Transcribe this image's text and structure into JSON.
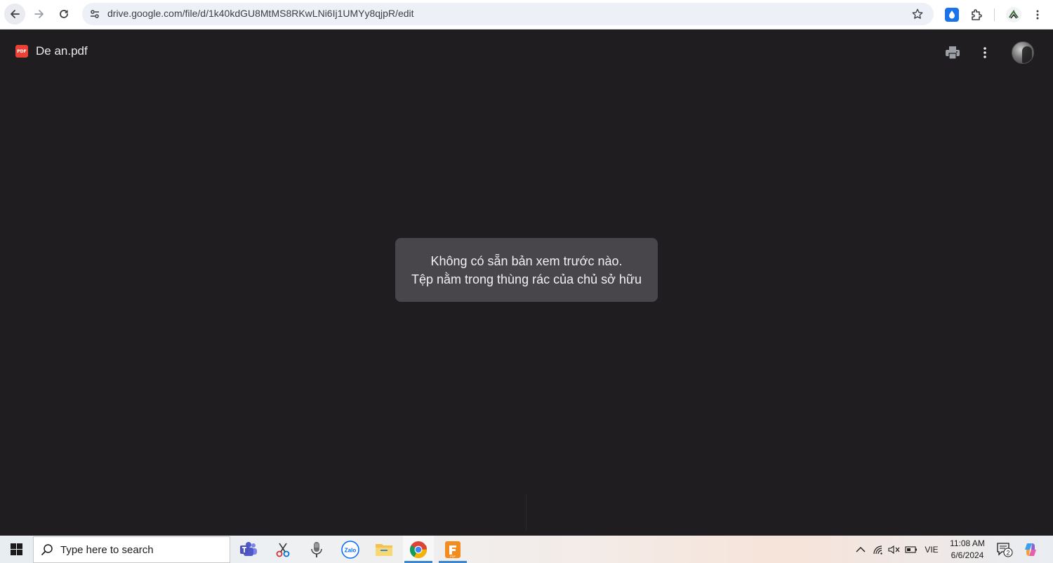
{
  "browser": {
    "url": "drive.google.com/file/d/1k40kdGU8MtMS8RKwLNi6Ij1UMYy8qjpR/edit",
    "accent": "#1a73e8"
  },
  "viewer": {
    "file_name": "De an.pdf",
    "file_type_badge": "PDF",
    "message_line1": "Không có sẵn bản xem trước nào.",
    "message_line2": "Tệp nằm trong thùng rác của chủ sở hữu",
    "background": "#1f1d20"
  },
  "taskbar": {
    "search_placeholder": "Type here to search",
    "apps": [
      "teams-icon",
      "snipping-tool-icon",
      "voice-recorder-icon",
      "zalo-icon",
      "file-explorer-icon",
      "chrome-icon",
      "foxit-pdf-icon"
    ],
    "zalo_label": "Zalo",
    "pdf_label": "PDF",
    "tray": {
      "language": "VIE",
      "time": "11:08 AM",
      "date": "6/6/2024",
      "notification_count": "2"
    }
  }
}
